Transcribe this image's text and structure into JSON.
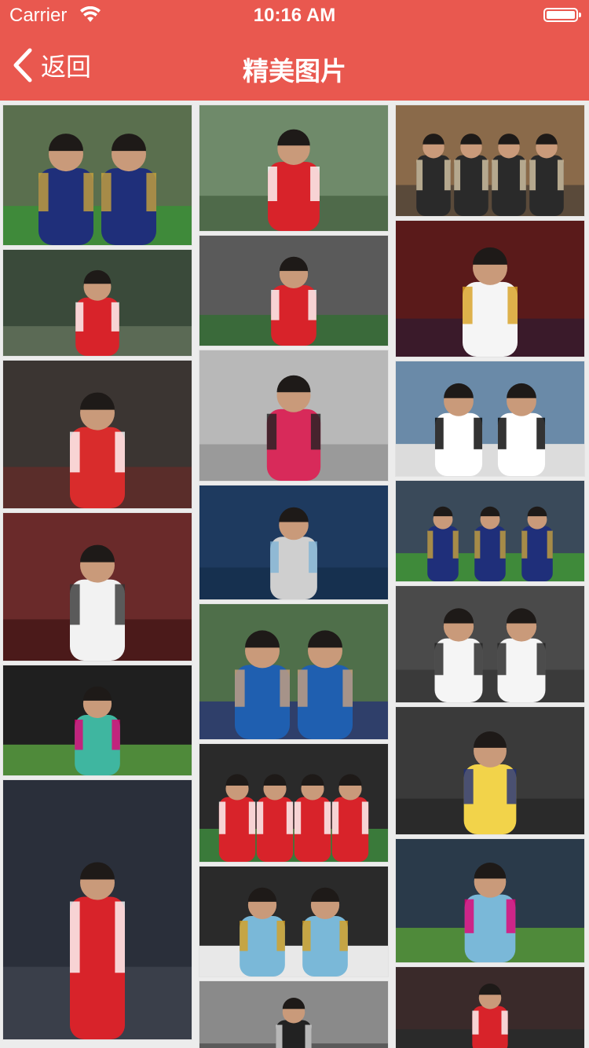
{
  "status_bar": {
    "carrier": "Carrier",
    "time": "10:16 AM",
    "battery_level": 1.0
  },
  "nav": {
    "back_label": "返回",
    "title": "精美图片"
  },
  "photos": {
    "columns": [
      [
        {
          "name": "photo-match-action",
          "bg": "#5a6f4e",
          "ground": "#3f8a3a",
          "kit": "#1f2f7a",
          "accent": "#c8a23c",
          "figures": 2,
          "h": 178
        },
        {
          "name": "photo-ozil-11-back",
          "bg": "#3a4a3a",
          "ground": "#5b6a55",
          "kit": "#d8232a",
          "accent": "#ffffff",
          "figures": 1,
          "h": 135
        },
        {
          "name": "photo-portrait-arsenal",
          "bg": "#3b3532",
          "ground": "#5a2d2a",
          "kit": "#d92c2c",
          "accent": "#ffffff",
          "figures": 1,
          "h": 188
        },
        {
          "name": "photo-real-madrid",
          "bg": "#6a2a2a",
          "ground": "#4b1a1a",
          "kit": "#f2f2f2",
          "accent": "#333333",
          "figures": 1,
          "h": 188
        },
        {
          "name": "photo-training-sap",
          "bg": "#1f1f1f",
          "ground": "#4f8a3a",
          "kit": "#3fb6a0",
          "accent": "#e20074",
          "figures": 1,
          "h": 140
        },
        {
          "name": "photo-ozil-11-standing",
          "bg": "#2a2f3a",
          "ground": "#3a3f4a",
          "kit": "#d8232a",
          "accent": "#ffffff",
          "figures": 1,
          "h": 330
        }
      ],
      [
        {
          "name": "photo-smile-red-jacket",
          "bg": "#6f8a6a",
          "ground": "#4f6a4a",
          "kit": "#d8232a",
          "accent": "#ffffff",
          "figures": 1,
          "h": 160
        },
        {
          "name": "photo-celebration",
          "bg": "#5a5a5a",
          "ground": "#3a6a3a",
          "kit": "#d8232a",
          "accent": "#ffffff",
          "figures": 1,
          "h": 140
        },
        {
          "name": "photo-portrait-gesture",
          "bg": "#b8b8b8",
          "ground": "#9a9a9a",
          "kit": "#d82a5a",
          "accent": "#222222",
          "figures": 1,
          "h": 166
        },
        {
          "name": "photo-awards-suit",
          "bg": "#1e3a5f",
          "ground": "#16304f",
          "kit": "#cfcfcf",
          "accent": "#7fb3d5",
          "figures": 1,
          "h": 145
        },
        {
          "name": "photo-with-manager",
          "bg": "#4f6f4a",
          "ground": "#2f3f6a",
          "kit": "#1f5fb0",
          "accent": "#c8a080",
          "figures": 2,
          "h": 172
        },
        {
          "name": "photo-team-celebration",
          "bg": "#2a2a2a",
          "ground": "#3a7a3a",
          "kit": "#d8232a",
          "accent": "#ffffff",
          "figures": 4,
          "h": 150
        },
        {
          "name": "photo-training-blue",
          "bg": "#2a2a2a",
          "ground": "#e8e8e8",
          "kit": "#7ab8d8",
          "accent": "#d8a020",
          "figures": 2,
          "h": 140
        },
        {
          "name": "photo-bw-portrait",
          "bg": "#8a8a8a",
          "ground": "#5a5a5a",
          "kit": "#222222",
          "accent": "#dddddd",
          "figures": 1,
          "h": 110
        }
      ],
      [
        {
          "name": "photo-street-group",
          "bg": "#8a6a4a",
          "ground": "#5a4a3a",
          "kit": "#2a2a2a",
          "accent": "#d8c8a8",
          "figures": 4,
          "h": 141
        },
        {
          "name": "photo-real-madrid-white",
          "bg": "#5a1a1a",
          "ground": "#3a1a2a",
          "kit": "#f5f5f5",
          "accent": "#d8a020",
          "figures": 1,
          "h": 173
        },
        {
          "name": "photo-germany-duo",
          "bg": "#6a8aa8",
          "ground": "#dcdcdc",
          "kit": "#ffffff",
          "accent": "#000000",
          "figures": 2,
          "h": 146
        },
        {
          "name": "photo-match-action-2",
          "bg": "#3a4a5a",
          "ground": "#3f8a3a",
          "kit": "#1f2f7a",
          "accent": "#c8a23c",
          "figures": 3,
          "h": 128
        },
        {
          "name": "photo-real-madrid-9",
          "bg": "#4a4a4a",
          "ground": "#3a3a3a",
          "kit": "#f5f5f5",
          "accent": "#222222",
          "figures": 2,
          "h": 148
        },
        {
          "name": "photo-clapping-yellow",
          "bg": "#3a3a3a",
          "ground": "#2a2a2a",
          "kit": "#f2d34a",
          "accent": "#1f2f7a",
          "figures": 1,
          "h": 162
        },
        {
          "name": "photo-training-telekom",
          "bg": "#2a3a4a",
          "ground": "#4f8a3a",
          "kit": "#7ab8d8",
          "accent": "#e20074",
          "figures": 1,
          "h": 157
        },
        {
          "name": "photo-arsenal-emirates",
          "bg": "#3a2a2a",
          "ground": "#2a2a2a",
          "kit": "#d8232a",
          "accent": "#ffffff",
          "figures": 1,
          "h": 110
        }
      ]
    ]
  }
}
